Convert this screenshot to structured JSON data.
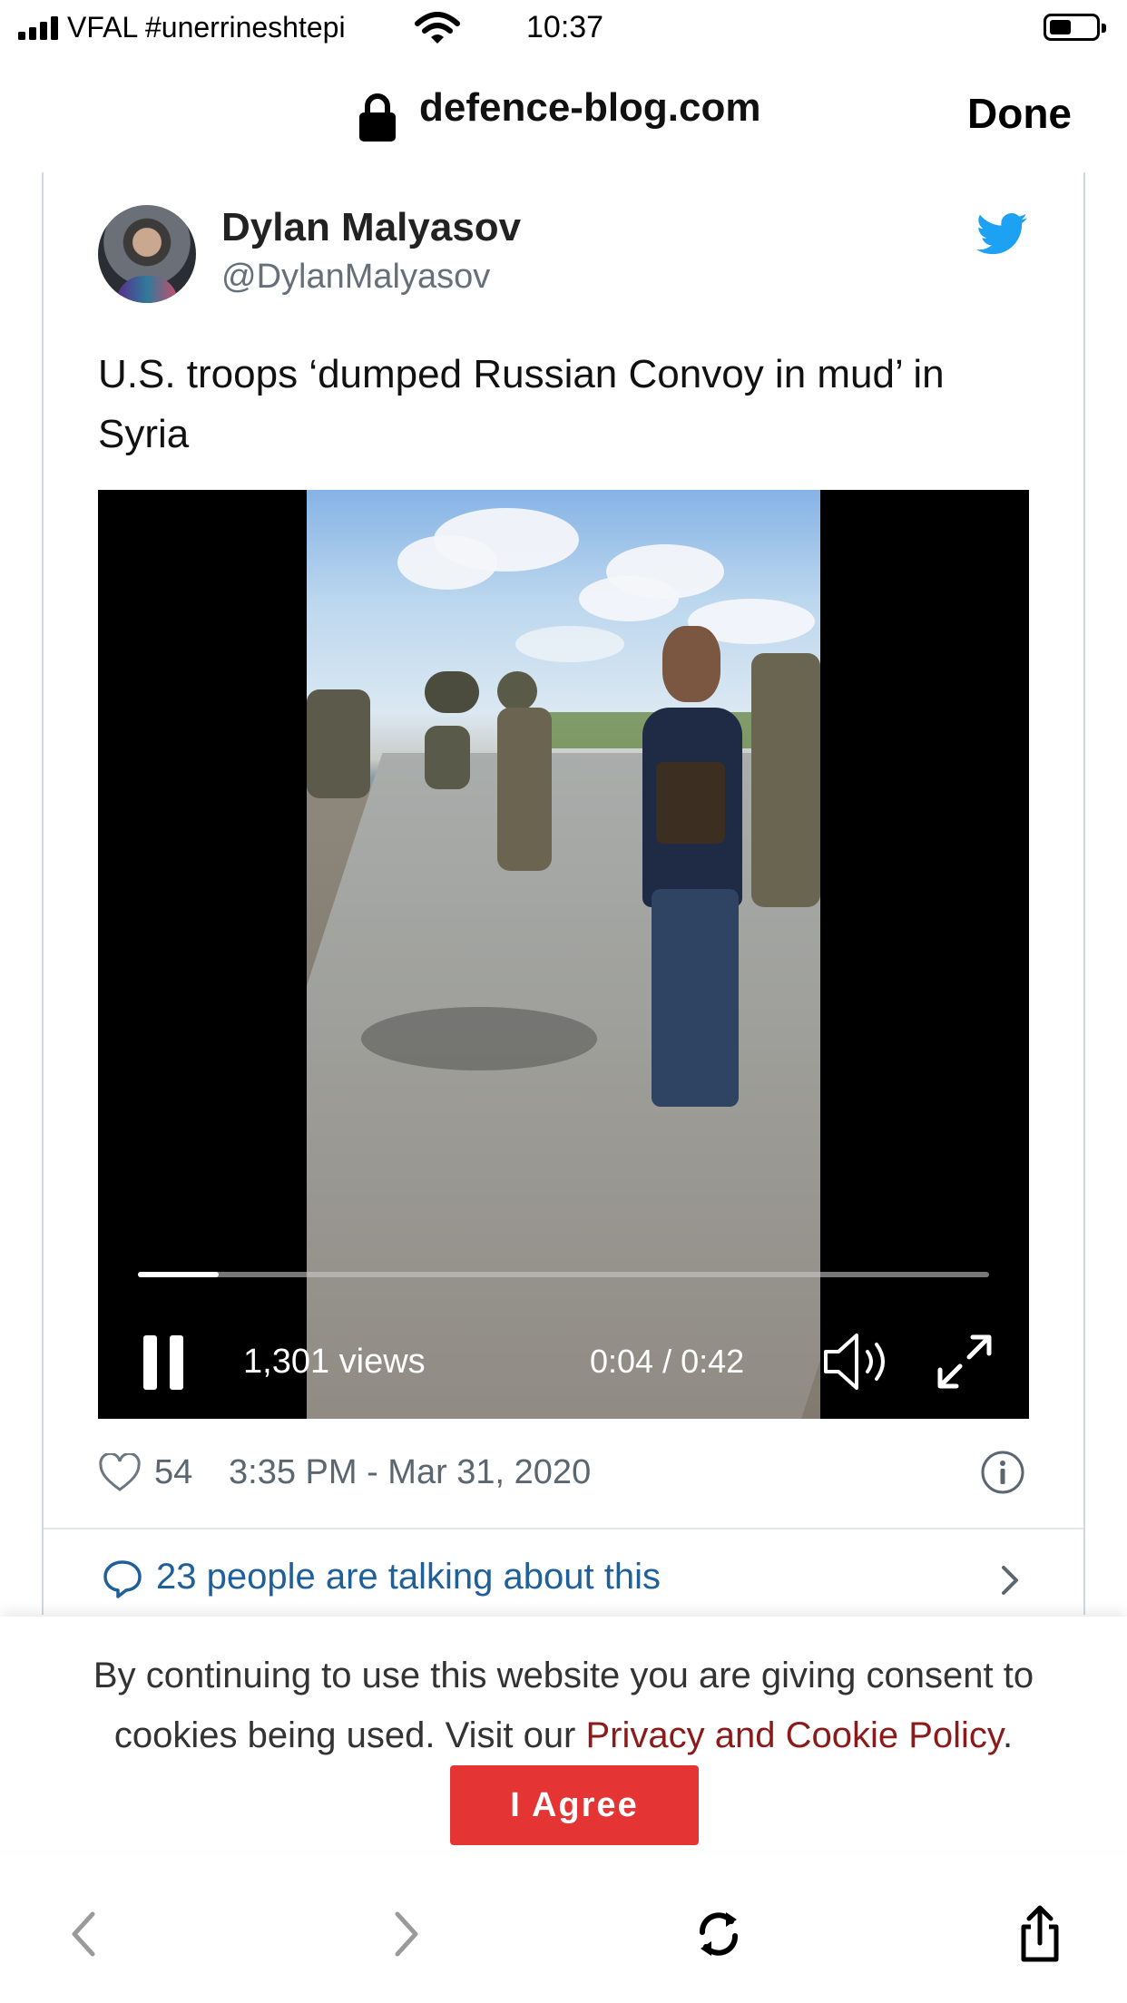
{
  "status_bar": {
    "carrier": "VFAL #unerrineshtepi",
    "time": "10:37",
    "battery_level": 0.45
  },
  "browser": {
    "domain": "defence-blog.com",
    "done_label": "Done",
    "icons": [
      "lock-icon",
      "back-icon",
      "forward-icon",
      "refresh-icon",
      "share-icon"
    ]
  },
  "tweet": {
    "author": "Dylan Malyasov",
    "handle": "@DylanMalyasov",
    "text": "U.S. troops ‘dumped Russian Convoy in mud’ in Syria",
    "likes": "54",
    "timestamp": "3:35 PM - Mar 31, 2020",
    "talking": "23 people are talking about this",
    "accent_color": "#1da1f2"
  },
  "video": {
    "views": "1,301 views",
    "time": "0:04 / 0:42",
    "progress": 0.095
  },
  "cookie": {
    "text_before": "By continuing to use this website you are giving consent to cookies being used. Visit our ",
    "link": "Privacy and Cookie Policy",
    "text_after": ".",
    "button": "I Agree",
    "button_color": "#e43434"
  }
}
